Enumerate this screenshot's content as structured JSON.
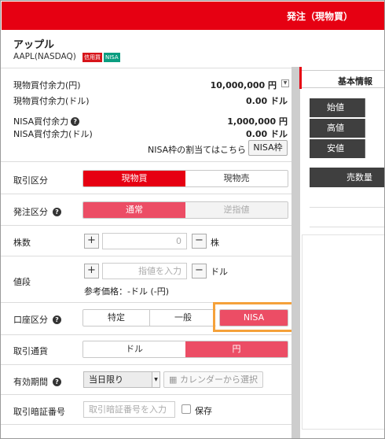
{
  "header": {
    "title": "発注（現物買）"
  },
  "stock": {
    "name": "アップル",
    "code": "AAPL(NASDAQ)",
    "badges": {
      "credit": "信用買",
      "nisa": "NISA"
    }
  },
  "balances": {
    "cash_jpy": {
      "label": "現物買付余力(円)",
      "value": "10,000,000 円"
    },
    "cash_usd": {
      "label": "現物買付余力(ドル)",
      "value": "0.00 ドル"
    },
    "nisa_jpy": {
      "label": "NISA買付余力",
      "value": "1,000,000 円"
    },
    "nisa_usd": {
      "label": "NISA買付余力(ドル)",
      "value": "0.00 ドル"
    },
    "nisa_link_text": "NISA枠の割当てはこちら",
    "nisa_button": "NISA枠"
  },
  "order": {
    "trade_type": {
      "label": "取引区分",
      "options": [
        "現物買",
        "現物売"
      ],
      "selected": "現物買"
    },
    "order_type": {
      "label": "発注区分",
      "options": [
        "通常",
        "逆指値"
      ],
      "selected": "通常"
    },
    "shares": {
      "label": "株数",
      "value": "0",
      "unit": "株",
      "plus": "+",
      "minus": "−"
    },
    "price": {
      "label": "値段",
      "placeholder": "指値を入力",
      "unit": "ドル",
      "reference": "参考価格：-ドル (-円)",
      "plus": "+",
      "minus": "−"
    },
    "account": {
      "label": "口座区分",
      "options": [
        "特定",
        "一般",
        "NISA"
      ],
      "selected": "NISA"
    },
    "currency": {
      "label": "取引通貨",
      "options": [
        "ドル",
        "円"
      ],
      "selected": "円"
    },
    "validity": {
      "label": "有効期間",
      "selected": "当日限り",
      "calendar_button": "カレンダーから選択"
    },
    "pin": {
      "label": "取引暗証番号",
      "placeholder": "取引暗証番号を入力",
      "save_label": "保存"
    }
  },
  "right_panel": {
    "tab": "基本情報",
    "rows": [
      "始値",
      "高値",
      "安値"
    ],
    "qty_header": "売数量"
  },
  "colors": {
    "accent_red": "#e60012",
    "pink": "#ec4d65",
    "highlight": "#f5a13a"
  }
}
